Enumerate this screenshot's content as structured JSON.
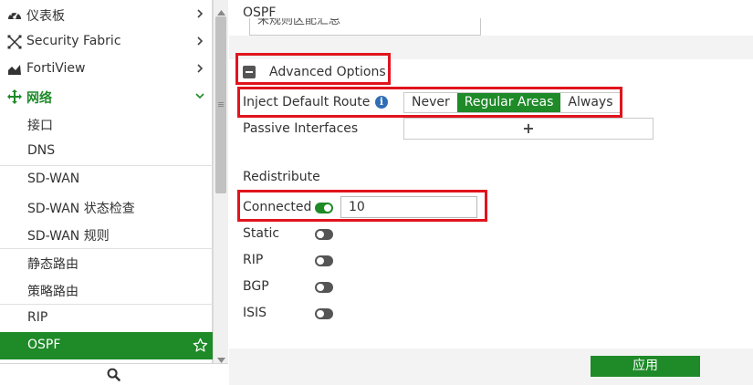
{
  "sidebar": {
    "items": [
      {
        "label": "仪表板",
        "icon": "dashboard-icon"
      },
      {
        "label": "Security Fabric",
        "icon": "security-fabric-icon"
      },
      {
        "label": "FortiView",
        "icon": "fortiview-icon"
      },
      {
        "label": "网络",
        "icon": "network-icon"
      },
      {
        "label": "接口"
      },
      {
        "label": "DNS"
      },
      {
        "label": "SD-WAN"
      },
      {
        "label": "SD-WAN 状态检查"
      },
      {
        "label": "SD-WAN 规则"
      },
      {
        "label": "静态路由"
      },
      {
        "label": "策略路由"
      },
      {
        "label": "RIP"
      },
      {
        "label": "OSPF"
      }
    ],
    "active_item": "OSPF",
    "search_icon": "search-icon",
    "favorite_icon": "star-icon"
  },
  "main": {
    "header_title": "OSPF",
    "partial_input_text": "未规则区配汇总",
    "advanced_options_label": "Advanced Options",
    "inject_default_route": {
      "label": "Inject Default Route",
      "options": [
        "Never",
        "Regular Areas",
        "Always"
      ],
      "selected": "Regular Areas"
    },
    "passive_interfaces": {
      "label": "Passive Interfaces",
      "add_symbol": "+"
    },
    "redistribute": {
      "title": "Redistribute",
      "connected": {
        "label": "Connected",
        "enabled": true,
        "value": "10"
      },
      "static": {
        "label": "Static",
        "enabled": false
      },
      "rip": {
        "label": "RIP",
        "enabled": false
      },
      "bgp": {
        "label": "BGP",
        "enabled": false
      },
      "isis": {
        "label": "ISIS",
        "enabled": false
      }
    },
    "apply_label": "应用"
  },
  "colors": {
    "accent_green": "#1e8a28",
    "highlight_red": "#e1141d",
    "info_blue": "#2f6eb5"
  }
}
